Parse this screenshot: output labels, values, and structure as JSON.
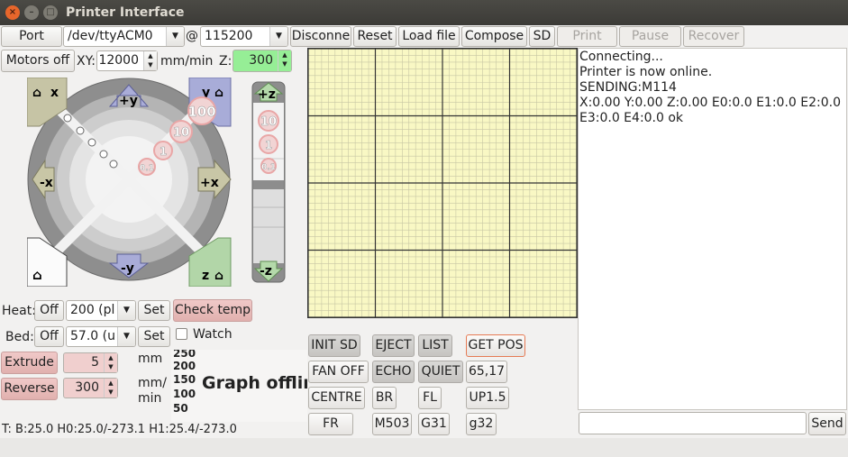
{
  "window": {
    "title": "Printer Interface",
    "close_glyph": "×",
    "min_glyph": "–",
    "max_glyph": "□"
  },
  "toolbar": {
    "port_label": "Port",
    "port_value": "/dev/ttyACM0",
    "at_label": "@",
    "baud_value": "115200",
    "disconnect_label": "Disconne",
    "reset_label": "Reset",
    "load_label": "Load file",
    "compose_label": "Compose",
    "sd_label": "SD",
    "print_label": "Print",
    "pause_label": "Pause",
    "recover_label": "Recover"
  },
  "motion": {
    "motors_off_label": "Motors off",
    "xy_label": "XY:",
    "xy_value": "12000",
    "xy_unit": "mm/min",
    "z_label": "Z:",
    "z_value": "300"
  },
  "jog": {
    "home_x": "x",
    "home_y": "y",
    "home_z": "z",
    "plus_y": "+y",
    "minus_y": "-y",
    "plus_x": "+x",
    "minus_x": "-x",
    "plus_z": "+z",
    "minus_z": "-z",
    "step_100": "100",
    "step_10": "10",
    "step_1": "1",
    "step_01": "0.1"
  },
  "temps": {
    "heat_label": "Heat:",
    "heat_off": "Off",
    "heat_value": "200 (pl",
    "heat_set": "Set",
    "check_temp": "Check temp",
    "bed_label": "Bed:",
    "bed_off": "Off",
    "bed_value": "57.0 (u",
    "bed_set": "Set",
    "watch_label": "Watch"
  },
  "extrude": {
    "extrude_label": "Extrude",
    "extrude_value": "5",
    "extrude_unit": "mm",
    "reverse_label": "Reverse",
    "reverse_value": "300",
    "reverse_unit_1": "mm/",
    "reverse_unit_2": "min"
  },
  "graph": {
    "ticks": [
      "250",
      "200",
      "150",
      "100",
      "50"
    ],
    "overlay": "Graph offlir"
  },
  "status": "T: B:25.0 H0:25.0/-273.1 H1:25.4/-273.0",
  "macros": {
    "init_sd": "INIT SD",
    "eject": "EJECT",
    "list": "LIST",
    "get_pos": "GET POS",
    "fan_off": "FAN OFF",
    "echo": "ECHO",
    "quiet": "QUIET",
    "m6517": "65,17",
    "centre": "CENTRE",
    "br": "BR",
    "fl": "FL",
    "up15": "UP1.5",
    "fr": "FR",
    "m503": "M503",
    "g31": "G31",
    "g32": "g32"
  },
  "console": {
    "lines": [
      "Connecting...",
      "Printer is now online.",
      "SENDING:M114",
      "X:0.00 Y:0.00 Z:0.00 E0:0.0 E1:0.0 E2:0.0",
      "E3:0.0 E4:0.0 ok"
    ],
    "send_label": "Send",
    "input_value": ""
  },
  "colors": {
    "plate_bg": "#f9f8c4",
    "grid_minor": "#c7c6a4",
    "grid_major": "#333333"
  }
}
